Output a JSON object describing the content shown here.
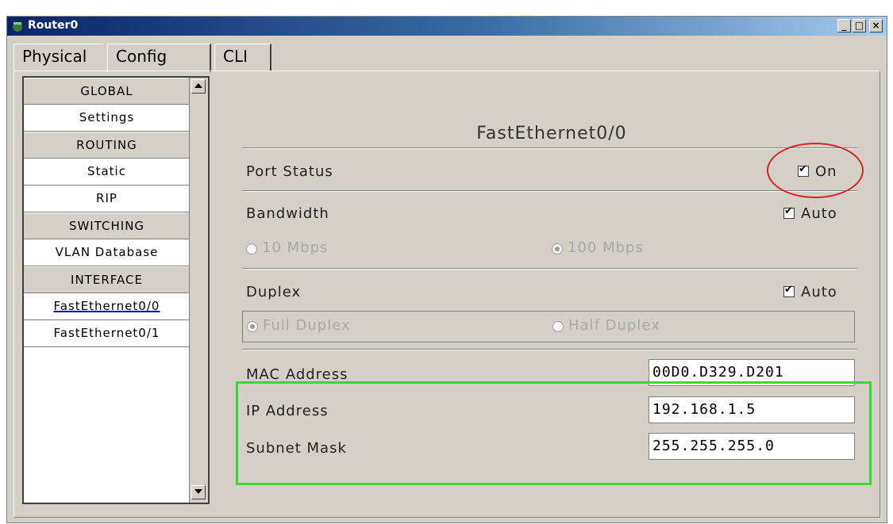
{
  "window": {
    "title": "Router0"
  },
  "tabs": [
    "Physical",
    "Config",
    "CLI"
  ],
  "sidebar": {
    "items": [
      {
        "label": "GLOBAL",
        "kind": "header"
      },
      {
        "label": "Settings",
        "kind": "item"
      },
      {
        "label": "ROUTING",
        "kind": "header"
      },
      {
        "label": "Static",
        "kind": "item"
      },
      {
        "label": "RIP",
        "kind": "item"
      },
      {
        "label": "SWITCHING",
        "kind": "header"
      },
      {
        "label": "VLAN Database",
        "kind": "item"
      },
      {
        "label": "INTERFACE",
        "kind": "header"
      },
      {
        "label": "FastEthernet0/0",
        "kind": "item",
        "active": true
      },
      {
        "label": "FastEthernet0/1",
        "kind": "item"
      }
    ]
  },
  "interface": {
    "title": "FastEthernet0/0",
    "port_status": {
      "label": "Port Status",
      "checkbox_label": "On",
      "checked": true
    },
    "bandwidth": {
      "label": "Bandwidth",
      "auto_label": "Auto",
      "auto_checked": true,
      "opt_10": "10 Mbps",
      "opt_100": "100 Mbps",
      "selected": "100 Mbps"
    },
    "duplex": {
      "label": "Duplex",
      "auto_label": "Auto",
      "auto_checked": true,
      "opt_full": "Full Duplex",
      "opt_half": "Half Duplex",
      "selected": "Full Duplex"
    },
    "mac": {
      "label": "MAC Address",
      "value": "00D0.D329.D201"
    },
    "ip": {
      "label": "IP Address",
      "value": "192.168.1.5"
    },
    "mask": {
      "label": "Subnet Mask",
      "value": "255.255.255.0"
    }
  },
  "colors": {
    "highlight_red": "#e02020",
    "highlight_green": "#33dd33",
    "titlebar": "#0a246a"
  }
}
